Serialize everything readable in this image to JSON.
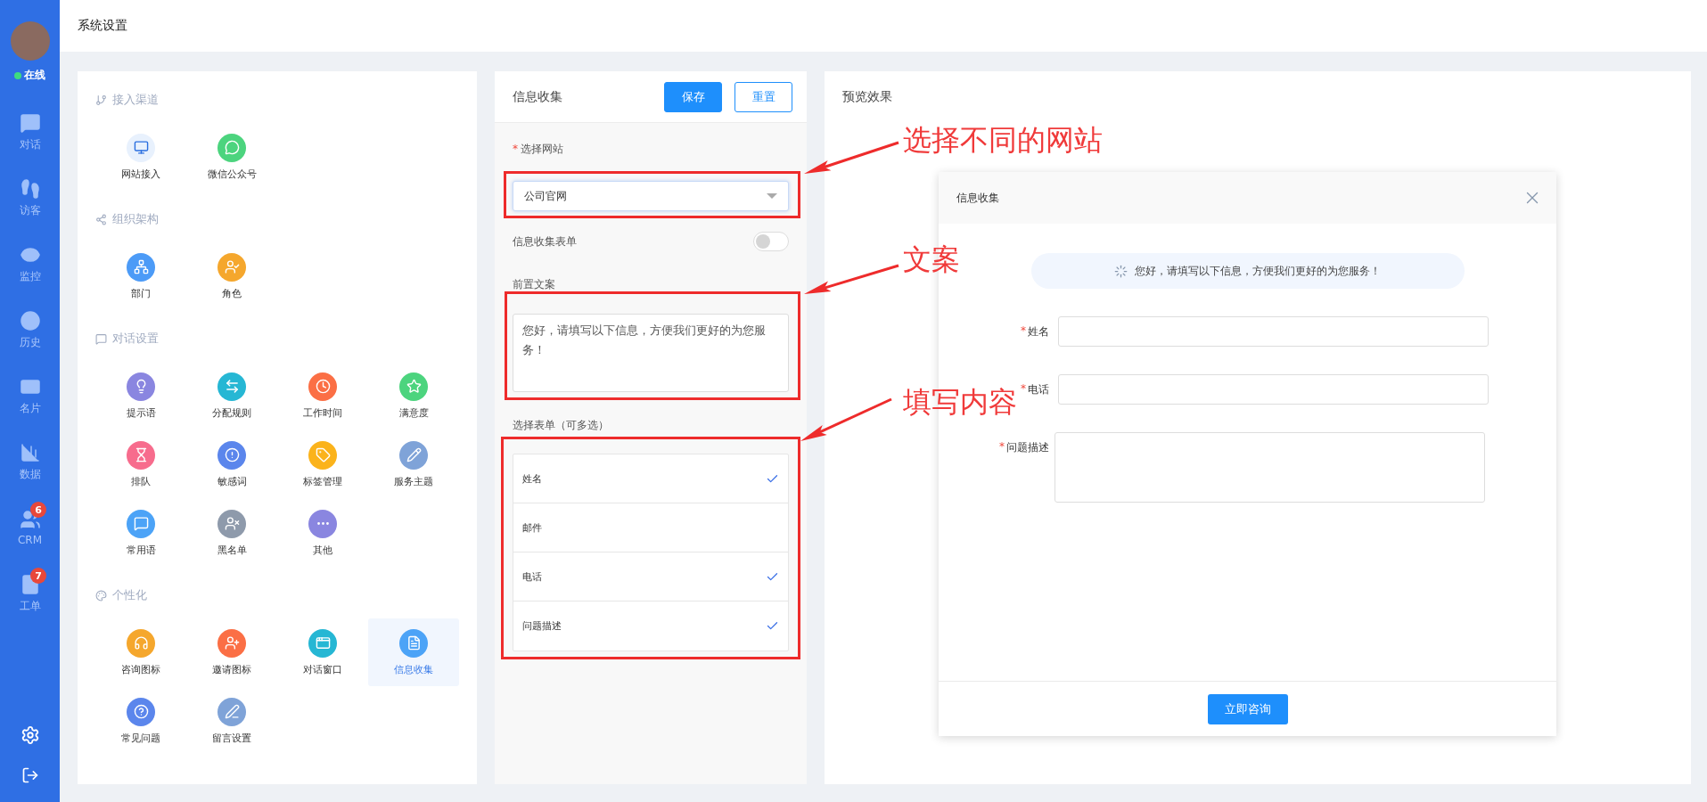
{
  "sidebar": {
    "status": {
      "label": "在线",
      "color": "#3fdc7f"
    },
    "nav": [
      {
        "label": "对话"
      },
      {
        "label": "访客"
      },
      {
        "label": "监控"
      },
      {
        "label": "历史"
      },
      {
        "label": "名片"
      },
      {
        "label": "数据"
      },
      {
        "label": "CRM",
        "badge": "6"
      },
      {
        "label": "工单",
        "badge": "7"
      }
    ]
  },
  "header": {
    "title": "系统设置"
  },
  "settings": {
    "sections": [
      {
        "title": "接入渠道",
        "items": [
          {
            "label": "网站接入",
            "color": "#e8f1fd",
            "selected": false
          },
          {
            "label": "微信公众号",
            "color": "#4cd47e",
            "selected": false
          }
        ]
      },
      {
        "title": "组织架构",
        "items": [
          {
            "label": "部门",
            "color": "#4c9bf7",
            "selected": false
          },
          {
            "label": "角色",
            "color": "#f5a72d",
            "selected": false
          }
        ]
      },
      {
        "title": "对话设置",
        "items": [
          {
            "label": "提示语",
            "color": "#8a86e0",
            "selected": false
          },
          {
            "label": "分配规则",
            "color": "#26b7d4",
            "selected": false
          },
          {
            "label": "工作时间",
            "color": "#fb6f45",
            "selected": false
          },
          {
            "label": "满意度",
            "color": "#4cd47e",
            "selected": false
          },
          {
            "label": "排队",
            "color": "#f76c8d",
            "selected": false
          },
          {
            "label": "敏感词",
            "color": "#5b86ec",
            "selected": false
          },
          {
            "label": "标签管理",
            "color": "#fbb31b",
            "selected": false
          },
          {
            "label": "服务主题",
            "color": "#7fa3d8",
            "selected": false
          },
          {
            "label": "常用语",
            "color": "#4ca3f7",
            "selected": false
          },
          {
            "label": "黑名单",
            "color": "#8e9aab",
            "selected": false
          },
          {
            "label": "其他",
            "color": "#8a86e0",
            "selected": false
          }
        ]
      },
      {
        "title": "个性化",
        "items": [
          {
            "label": "咨询图标",
            "color": "#f5a72d",
            "selected": false
          },
          {
            "label": "邀请图标",
            "color": "#fb6f45",
            "selected": false
          },
          {
            "label": "对话窗口",
            "color": "#26b7d4",
            "selected": false
          },
          {
            "label": "信息收集",
            "color": "#4ca3f7",
            "selected": true
          },
          {
            "label": "常见问题",
            "color": "#5b86ec",
            "selected": false
          },
          {
            "label": "留言设置",
            "color": "#7fa3d8",
            "selected": false
          }
        ]
      }
    ]
  },
  "form_panel": {
    "title": "信息收集",
    "buttons": [
      {
        "label": "保存",
        "kind": "primary"
      },
      {
        "label": "重置",
        "kind": "outline"
      }
    ],
    "site": {
      "mark": "*",
      "label": "选择网站",
      "value": "公司官网"
    },
    "form_toggle": {
      "label": "信息收集表单",
      "on": false
    },
    "intro": {
      "label": "前置文案",
      "value": "您好，请填写以下信息，方便我们更好的为您服务！"
    },
    "fields": {
      "label": "选择表单（可多选）",
      "items": [
        {
          "label": "姓名",
          "checked": true
        },
        {
          "label": "邮件",
          "checked": false
        },
        {
          "label": "电话",
          "checked": true
        },
        {
          "label": "问题描述",
          "checked": true
        }
      ]
    }
  },
  "preview": {
    "title": "预览效果",
    "dialog": {
      "title": "信息收集",
      "notice": "您好，请填写以下信息，方便我们更好的为您服务！",
      "fields": [
        {
          "mark": "*",
          "label": "姓名",
          "kind": "input"
        },
        {
          "mark": "*",
          "label": "电话",
          "kind": "input"
        },
        {
          "mark": "*",
          "label": "问题描述",
          "kind": "textarea"
        }
      ],
      "submit": "立即咨询"
    }
  },
  "annotations": [
    {
      "text": "选择不同的网站"
    },
    {
      "text": "文案"
    },
    {
      "text": "填写内容"
    }
  ]
}
